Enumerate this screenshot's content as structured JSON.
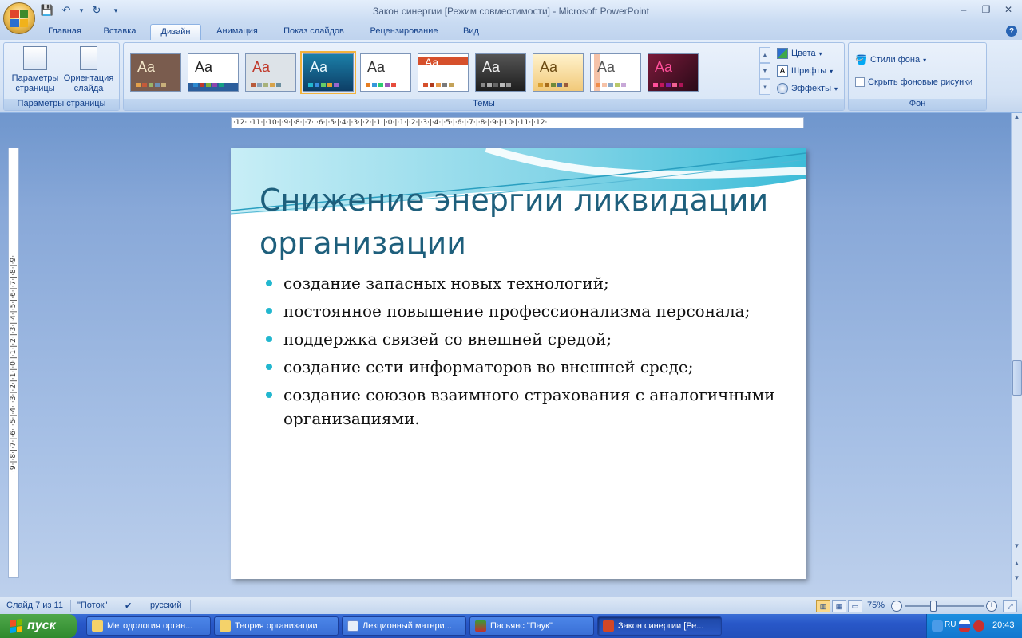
{
  "window": {
    "title": "Закон синергии [Режим совместимости] - Microsoft PowerPoint",
    "controls": [
      "–",
      "❐",
      "✕"
    ]
  },
  "quick_access": {
    "save": "💾",
    "undo": "↶",
    "redo": "↻",
    "customize": "▾"
  },
  "tabs": [
    {
      "label": "Главная"
    },
    {
      "label": "Вставка"
    },
    {
      "label": "Дизайн",
      "active": true
    },
    {
      "label": "Анимация"
    },
    {
      "label": "Показ слайдов"
    },
    {
      "label": "Рецензирование"
    },
    {
      "label": "Вид"
    }
  ],
  "ribbon": {
    "page_setup": {
      "page_params": "Параметры страницы",
      "orientation": "Ориентация слайда",
      "label": "Параметры страницы"
    },
    "themes": {
      "label": "Темы",
      "aa": "Aa"
    },
    "theme_cmds": {
      "colors": "Цвета",
      "fonts": "Шрифты",
      "effects": "Эффекты"
    },
    "background": {
      "styles": "Стили фона",
      "hide": "Скрыть фоновые рисунки",
      "label": "Фон"
    }
  },
  "ruler": {
    "horizontal": "·12·|·11·|·10·|·9·|·8·|·7·|·6·|·5·|·4·|·3·|·2·|·1·|·0·|·1·|·2·|·3·|·4·|·5·|·6·|·7·|·8·|·9·|·10·|·11·|·12·",
    "vertical": "·9·|·8·|·7·|·6·|·5·|·4·|·3·|·2·|·1·|·0·|·1·|·2·|·3·|·4·|·5·|·6·|·7·|·8·|·9·"
  },
  "slide": {
    "title": "Снижение энергии ликвидации организации",
    "bullets": [
      "создание запасных новых технологий;",
      "постоянное повышение профессионализма персонала;",
      "поддержка связей со внешней средой;",
      "создание сети информаторов во внешней среде;",
      "создание союзов взаимного страхования с аналогичными организациями."
    ]
  },
  "status": {
    "slide_num": "Слайд 7 из 11",
    "theme": "\"Поток\"",
    "language": "русский",
    "zoom": "75%"
  },
  "taskbar": {
    "start": "пуск",
    "tasks": [
      {
        "label": "Методология орган..."
      },
      {
        "label": "Теория организации"
      },
      {
        "label": "Лекционный матери..."
      },
      {
        "label": "Пасьянс \"Паук\""
      },
      {
        "label": "Закон синергии [Ре...",
        "active": true
      }
    ],
    "time": "20:43",
    "lang": "RU"
  },
  "colors": {
    "accent": "#22b7cf",
    "title": "#1e5f7c",
    "ribbon_text": "#15428b",
    "taskbar": "#2350bb"
  }
}
